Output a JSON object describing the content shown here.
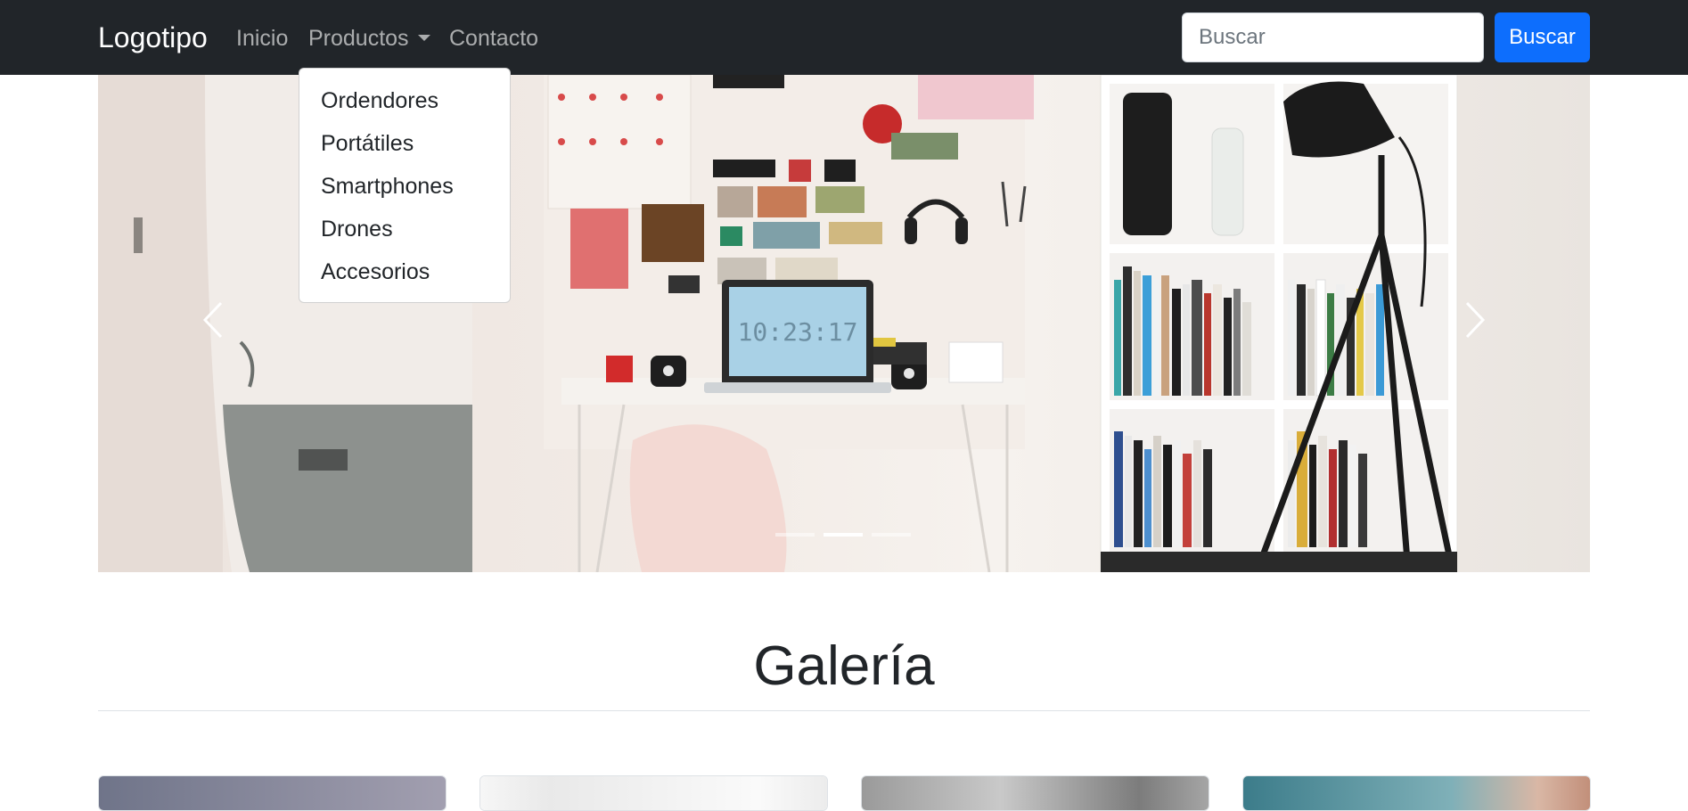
{
  "navbar": {
    "brand": "Logotipo",
    "links": [
      {
        "label": "Inicio"
      },
      {
        "label": "Productos"
      },
      {
        "label": "Contacto"
      }
    ],
    "search": {
      "placeholder": "Buscar",
      "value": ""
    },
    "search_button": "Buscar"
  },
  "dropdown": {
    "items": [
      "Ordendores",
      "Portátiles",
      "Smartphones",
      "Drones",
      "Accesorios"
    ]
  },
  "carousel": {
    "slide_count": 3,
    "active_index": 1,
    "clock_text": "10:23:17"
  },
  "gallery": {
    "title": "Galería",
    "cards": 4
  },
  "colors": {
    "navbar": "#212529",
    "primary": "#0d6efd",
    "text": "#212529",
    "divider": "#dee2e6"
  }
}
